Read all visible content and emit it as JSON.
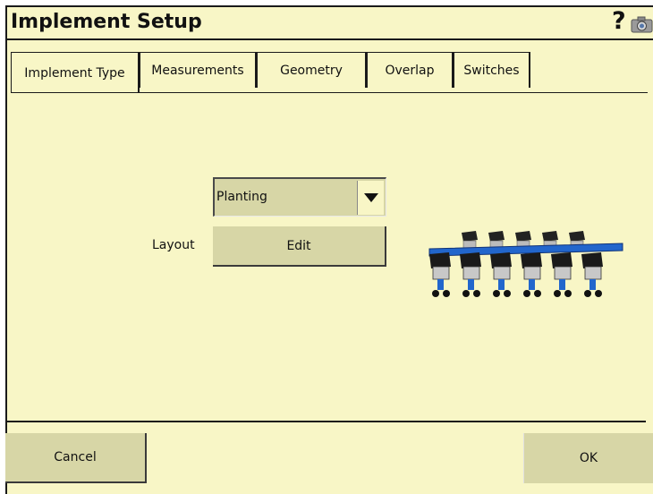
{
  "window": {
    "title": "Implement Setup",
    "help_glyph": "?",
    "help_icon": "help-icon",
    "camera_icon": "camera-icon"
  },
  "tabs": [
    {
      "label": "Implement Type",
      "active": true
    },
    {
      "label": "Measurements",
      "active": false
    },
    {
      "label": "Geometry",
      "active": false
    },
    {
      "label": "Overlap",
      "active": false
    },
    {
      "label": "Switches",
      "active": false
    }
  ],
  "implement_type": {
    "selected": "Planting",
    "layout_label": "Layout",
    "edit_label": "Edit",
    "image": "planter-implement-illustration"
  },
  "footer": {
    "cancel_label": "Cancel",
    "ok_label": "OK"
  },
  "colors": {
    "background": "#f8f6c6",
    "button": "#d7d6a6",
    "implement_bar": "#2266cc"
  }
}
